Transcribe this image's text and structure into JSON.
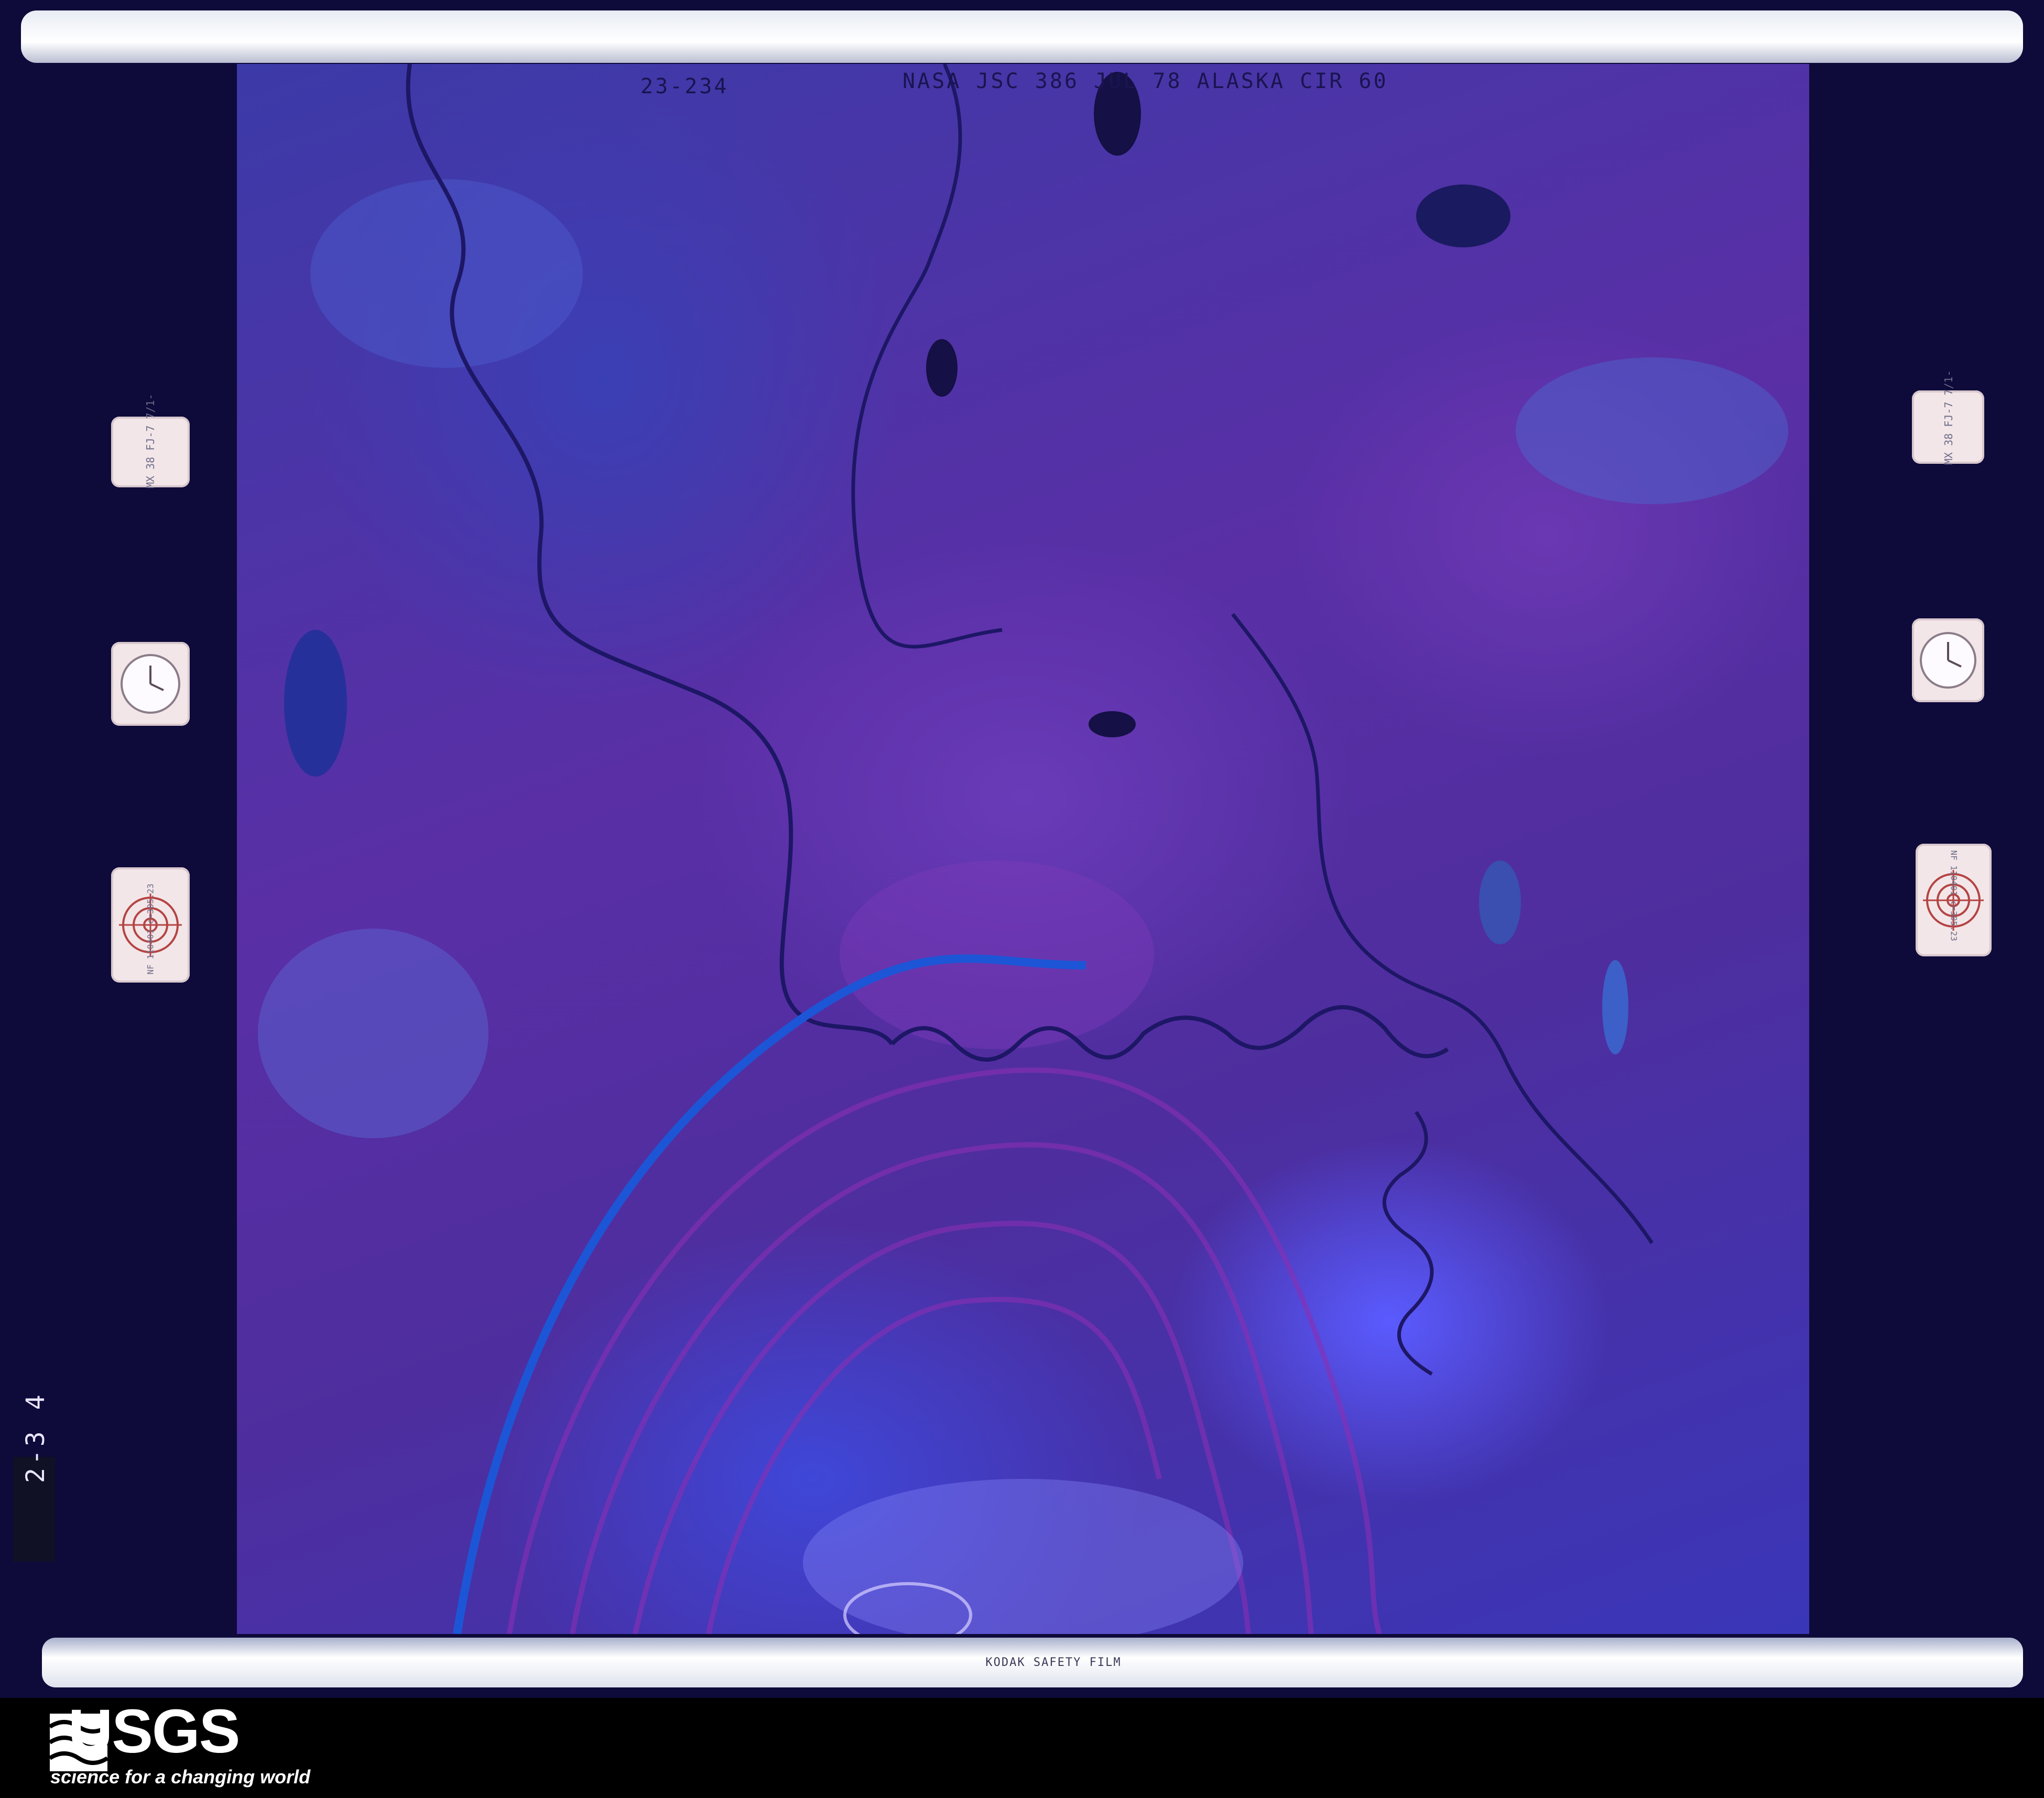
{
  "photo": {
    "frame_number": "23-234",
    "mission_annotation": "NASA JSC 386 JUL 78 ALASKA CIR 60",
    "frame_number_side": "2-3 4"
  },
  "film": {
    "edge_text": "KODAK SAFETY FILM"
  },
  "markers": {
    "left_counter_text": "MX 38 FJ-7 7/1-",
    "right_counter_text": "MX 38 FJ-7 7/1-",
    "left_calibration_text": "NF 110401 c=305.23",
    "right_calibration_text": "NF 110401 c=305.23"
  },
  "branding": {
    "logo_text": "USGS",
    "tagline": "science for a changing world"
  },
  "colors": {
    "film_base": "#0e0a3a",
    "photo_purple": "#5a2fa6",
    "photo_blue": "#3c3aa8",
    "river_channel": "#1d1766",
    "river_highlight": "#1c56d6"
  }
}
